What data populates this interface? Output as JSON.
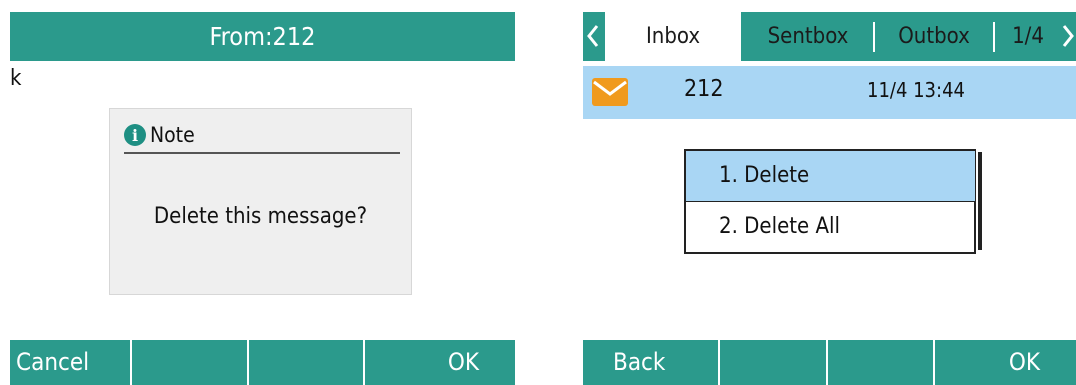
{
  "left_screen": {
    "title": "From:212",
    "body_text": "k",
    "dialog": {
      "title": "Note",
      "message": "Delete this message?"
    },
    "softkeys": [
      "Cancel",
      "",
      "",
      "OK"
    ]
  },
  "right_screen": {
    "tabs": [
      "Inbox",
      "Sentbox",
      "Outbox",
      "1/4"
    ],
    "active_tab": "Inbox",
    "message": {
      "from": "212",
      "time": "11/4 13:44"
    },
    "menu": {
      "items": [
        "1. Delete",
        "2. Delete All"
      ],
      "selected_index": 0
    },
    "softkeys": [
      "Back",
      "",
      "",
      "OK"
    ]
  },
  "colors": {
    "teal": "#2b9a8c",
    "highlight": "#a9d6f4",
    "envelope": "#f09a1e",
    "dialog_bg": "#efefef"
  }
}
